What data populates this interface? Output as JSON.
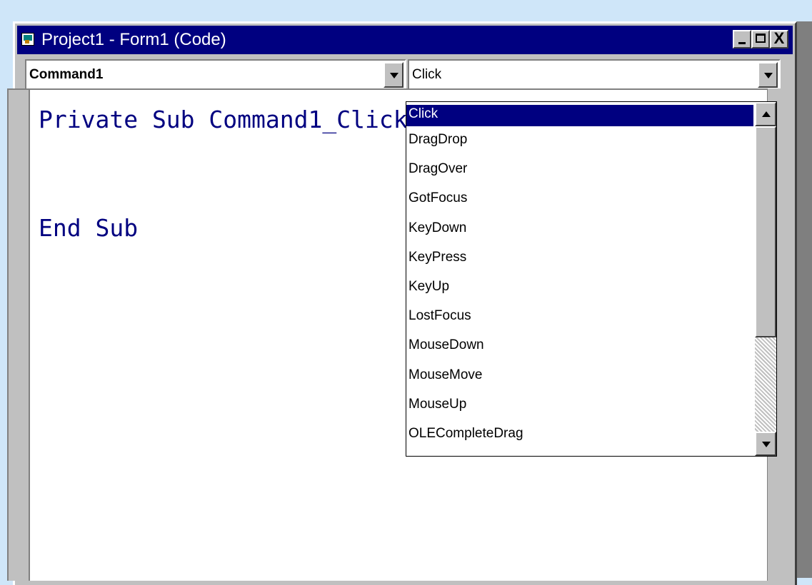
{
  "window": {
    "title": "Project1 - Form1 (Code)",
    "close_glyph": "X"
  },
  "object_combo": {
    "value": "Command1"
  },
  "procedure_combo": {
    "value": "Click"
  },
  "code": {
    "lines": [
      "Private Sub Command1_Click()",
      "",
      "End Sub"
    ]
  },
  "procedure_list": {
    "items": [
      "Click",
      "DragDrop",
      "DragOver",
      "GotFocus",
      "KeyDown",
      "KeyPress",
      "KeyUp",
      "LostFocus",
      "MouseDown",
      "MouseMove",
      "MouseUp",
      "OLECompleteDrag"
    ],
    "selected": "Click"
  },
  "icons": {
    "title": "form-window-icon",
    "minimize": "minimize-icon",
    "maximize": "maximize-icon",
    "close": "close-icon",
    "dropdown": "chevron-down-icon",
    "scroll_up": "scroll-up-arrow-icon",
    "scroll_down": "scroll-down-arrow-icon"
  },
  "colors": {
    "titlebar": "#000080",
    "code_text": "#000080",
    "selection": "#000080",
    "window_face": "#c0c0c0",
    "background": "#cfe6f9"
  }
}
